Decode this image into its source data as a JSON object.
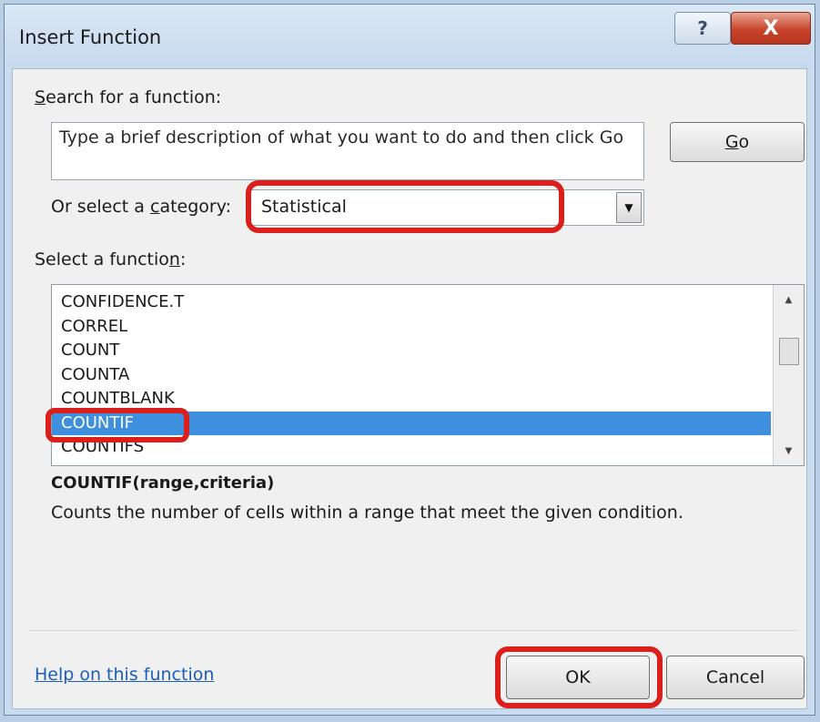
{
  "window": {
    "title": "Insert Function",
    "help_glyph": "?",
    "close_glyph": "X"
  },
  "search": {
    "label_pre": "",
    "label_accel": "S",
    "label_post": "earch for a function:",
    "value": "Type a brief description of what you want to do and then click Go",
    "go_pre": "",
    "go_accel": "G",
    "go_post": "o"
  },
  "category": {
    "label_pre": "Or select a ",
    "label_accel": "c",
    "label_post": "ategory:",
    "selected": "Statistical"
  },
  "functions": {
    "label_pre": "Select a functio",
    "label_accel": "n",
    "label_post": ":",
    "items": [
      "CONFIDENCE.T",
      "CORREL",
      "COUNT",
      "COUNTA",
      "COUNTBLANK",
      "COUNTIF",
      "COUNTIFS"
    ],
    "selected_index": 5
  },
  "details": {
    "signature": "COUNTIF(range,criteria)",
    "description": "Counts the number of cells within a range that meet the given condition."
  },
  "footer": {
    "help_link": "Help on this function",
    "ok_label": "OK",
    "cancel_label": "Cancel"
  },
  "colors": {
    "highlight": "#d9201d",
    "selection": "#3e8fde"
  }
}
